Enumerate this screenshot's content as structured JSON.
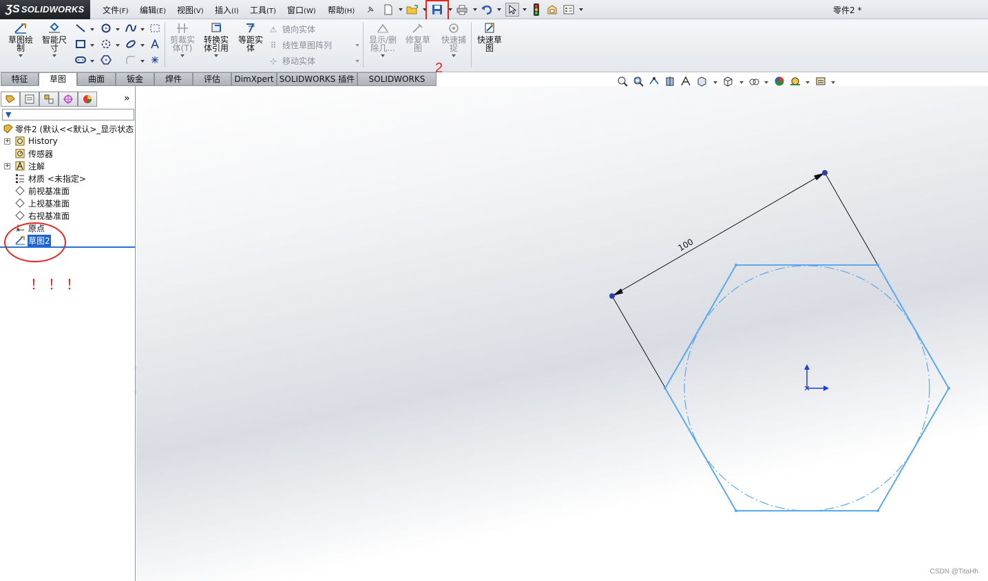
{
  "app": {
    "logo_text": "SOLIDWORKS",
    "doc_title": "零件2 *"
  },
  "menu": [
    {
      "label": "文件",
      "key": "(F)"
    },
    {
      "label": "编辑",
      "key": "(E)"
    },
    {
      "label": "视图",
      "key": "(V)"
    },
    {
      "label": "插入",
      "key": "(I)"
    },
    {
      "label": "工具",
      "key": "(T)"
    },
    {
      "label": "窗口",
      "key": "(W)"
    },
    {
      "label": "帮助",
      "key": "(H)"
    }
  ],
  "quick_access": [
    "pin-icon",
    "new-document-icon",
    "open-folder-icon",
    "save-icon",
    "print-icon",
    "undo-icon",
    "select-pointer-icon",
    "rebuild-traffic-light-icon",
    "file-properties-icon",
    "options-icon"
  ],
  "annotation_number": "2",
  "annotation_exclaim": "！！！",
  "commands": {
    "sketch": "草图绘\n制",
    "smart_dimension": "智能尺\n寸",
    "trim": "剪裁实\n体(T)",
    "convert": "转换实\n体引用",
    "offset": "等距实\n体",
    "mirror": "镜向实体",
    "linear_pattern": "线性草图阵列",
    "move": "移动实体",
    "display_delete": "显示/删\n除几...",
    "repair": "修复草\n图",
    "rapid_snap": "快速捕\n捉",
    "rapid_sketch": "快速草\n图"
  },
  "tabs": [
    "特征",
    "草图",
    "曲面",
    "钣金",
    "焊件",
    "评估",
    "DimXpert",
    "SOLIDWORKS 插件",
    "SOLIDWORKS MBD"
  ],
  "active_tab": "草图",
  "tree": {
    "root": "零件2 (默认<<默认>_显示状态",
    "items": [
      {
        "label": "History",
        "icon": "history-icon"
      },
      {
        "label": "传感器",
        "icon": "sensor-icon"
      },
      {
        "label": "注解",
        "icon": "annotation-icon"
      },
      {
        "label": "材质 <未指定>",
        "icon": "material-icon"
      },
      {
        "label": "前视基准面",
        "icon": "plane-icon"
      },
      {
        "label": "上视基准面",
        "icon": "plane-icon"
      },
      {
        "label": "右视基准面",
        "icon": "plane-icon"
      },
      {
        "label": "原点",
        "icon": "origin-icon"
      },
      {
        "label": "草图2",
        "icon": "sketch-icon"
      }
    ]
  },
  "sketch": {
    "dimension_value": "100",
    "shape": "hexagon",
    "line_color": "#5aa8ee",
    "construction_circle": true
  },
  "watermark": "CSDN @TitaHh",
  "colors": {
    "accent_red": "#e8231f",
    "selection_blue": "#1c64d0"
  }
}
